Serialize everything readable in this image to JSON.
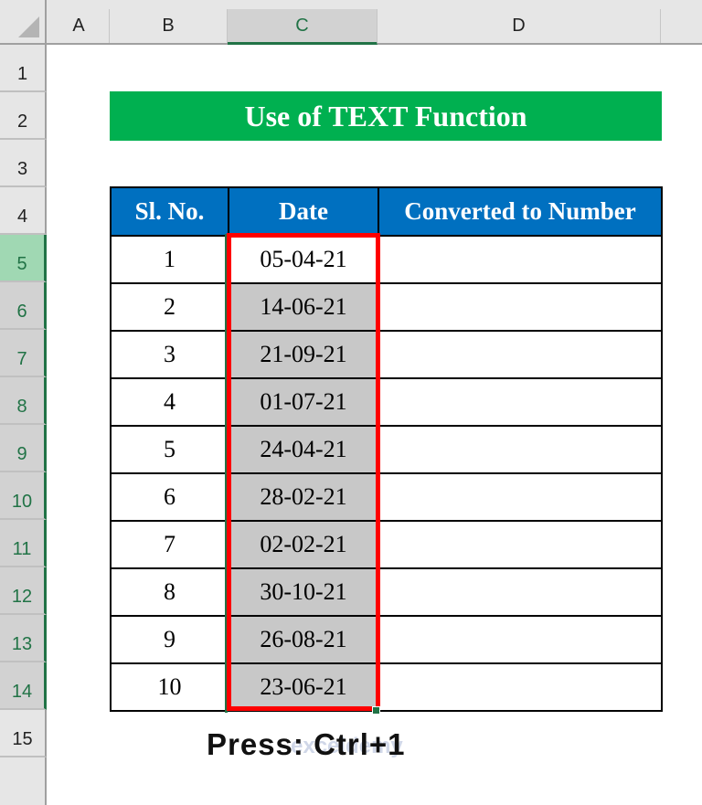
{
  "spreadsheet": {
    "columns": [
      "A",
      "B",
      "C",
      "D"
    ],
    "selected_column": "C",
    "rows": [
      "1",
      "2",
      "3",
      "4",
      "5",
      "6",
      "7",
      "8",
      "9",
      "10",
      "11",
      "12",
      "13",
      "14",
      "15"
    ],
    "active_row": "5",
    "selected_rows": [
      "6",
      "7",
      "8",
      "9",
      "10",
      "11",
      "12",
      "13",
      "14"
    ]
  },
  "title": "Use of TEXT Function",
  "table": {
    "headers": [
      "Sl. No.",
      "Date",
      "Converted to Number"
    ],
    "rows": [
      {
        "sl": "1",
        "date": "05-04-21",
        "converted": ""
      },
      {
        "sl": "2",
        "date": "14-06-21",
        "converted": ""
      },
      {
        "sl": "3",
        "date": "21-09-21",
        "converted": ""
      },
      {
        "sl": "4",
        "date": "01-07-21",
        "converted": ""
      },
      {
        "sl": "5",
        "date": "24-04-21",
        "converted": ""
      },
      {
        "sl": "6",
        "date": "28-02-21",
        "converted": ""
      },
      {
        "sl": "7",
        "date": "02-02-21",
        "converted": ""
      },
      {
        "sl": "8",
        "date": "30-10-21",
        "converted": ""
      },
      {
        "sl": "9",
        "date": "26-08-21",
        "converted": ""
      },
      {
        "sl": "10",
        "date": "23-06-21",
        "converted": ""
      }
    ]
  },
  "caption": "Press: Ctrl+1",
  "watermark": "exceldemy",
  "colors": {
    "title_bg": "#00b050",
    "header_bg": "#0070c0",
    "selection_border": "#ff0000",
    "selected_fill": "#c8c8c8",
    "excel_green": "#217346"
  }
}
